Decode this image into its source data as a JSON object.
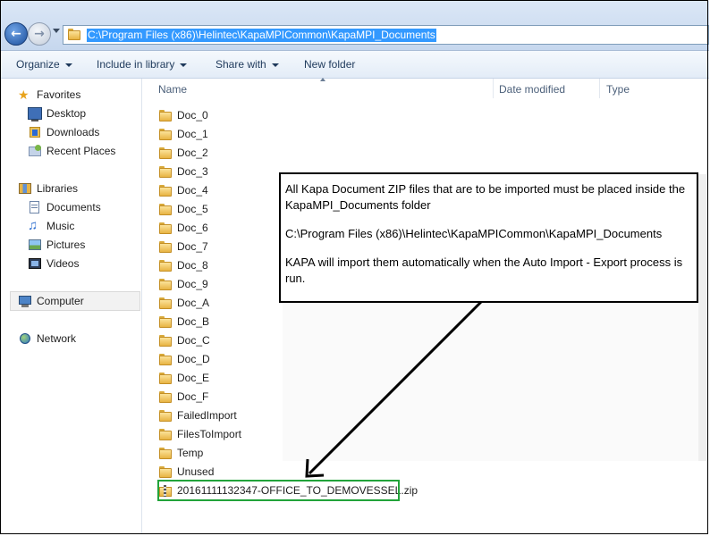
{
  "address": {
    "path": "C:\\Program Files (x86)\\Helintec\\KapaMPICommon\\KapaMPI_Documents"
  },
  "toolbar": {
    "organize": "Organize",
    "include_in_library": "Include in library",
    "share_with": "Share with",
    "new_folder": "New folder"
  },
  "nav": {
    "favorites": "Favorites",
    "desktop": "Desktop",
    "downloads": "Downloads",
    "recent_places": "Recent Places",
    "libraries": "Libraries",
    "documents": "Documents",
    "music": "Music",
    "pictures": "Pictures",
    "videos": "Videos",
    "computer": "Computer",
    "network": "Network"
  },
  "columns": {
    "name": "Name",
    "date_modified": "Date modified",
    "type": "Type"
  },
  "files": [
    "Doc_0",
    "Doc_1",
    "Doc_2",
    "Doc_3",
    "Doc_4",
    "Doc_5",
    "Doc_6",
    "Doc_7",
    "Doc_8",
    "Doc_9",
    "Doc_A",
    "Doc_B",
    "Doc_C",
    "Doc_D",
    "Doc_E",
    "Doc_F",
    "FailedImport",
    "FilesToImport",
    "Temp",
    "Unused",
    "20161111132347-OFFICE_TO_DEMOVESSEL.zip"
  ],
  "callout": {
    "line1": "All Kapa Document ZIP files that are to be imported must be placed inside the KapaMPI_Documents folder",
    "line2": "C:\\Program Files (x86)\\Helintec\\KapaMPICommon\\KapaMPI_Documents",
    "line3": "KAPA will import them automatically when the Auto Import - Export process is run."
  },
  "colors": {
    "highlight_border": "#22a33a",
    "address_selection": "#3399ff"
  }
}
